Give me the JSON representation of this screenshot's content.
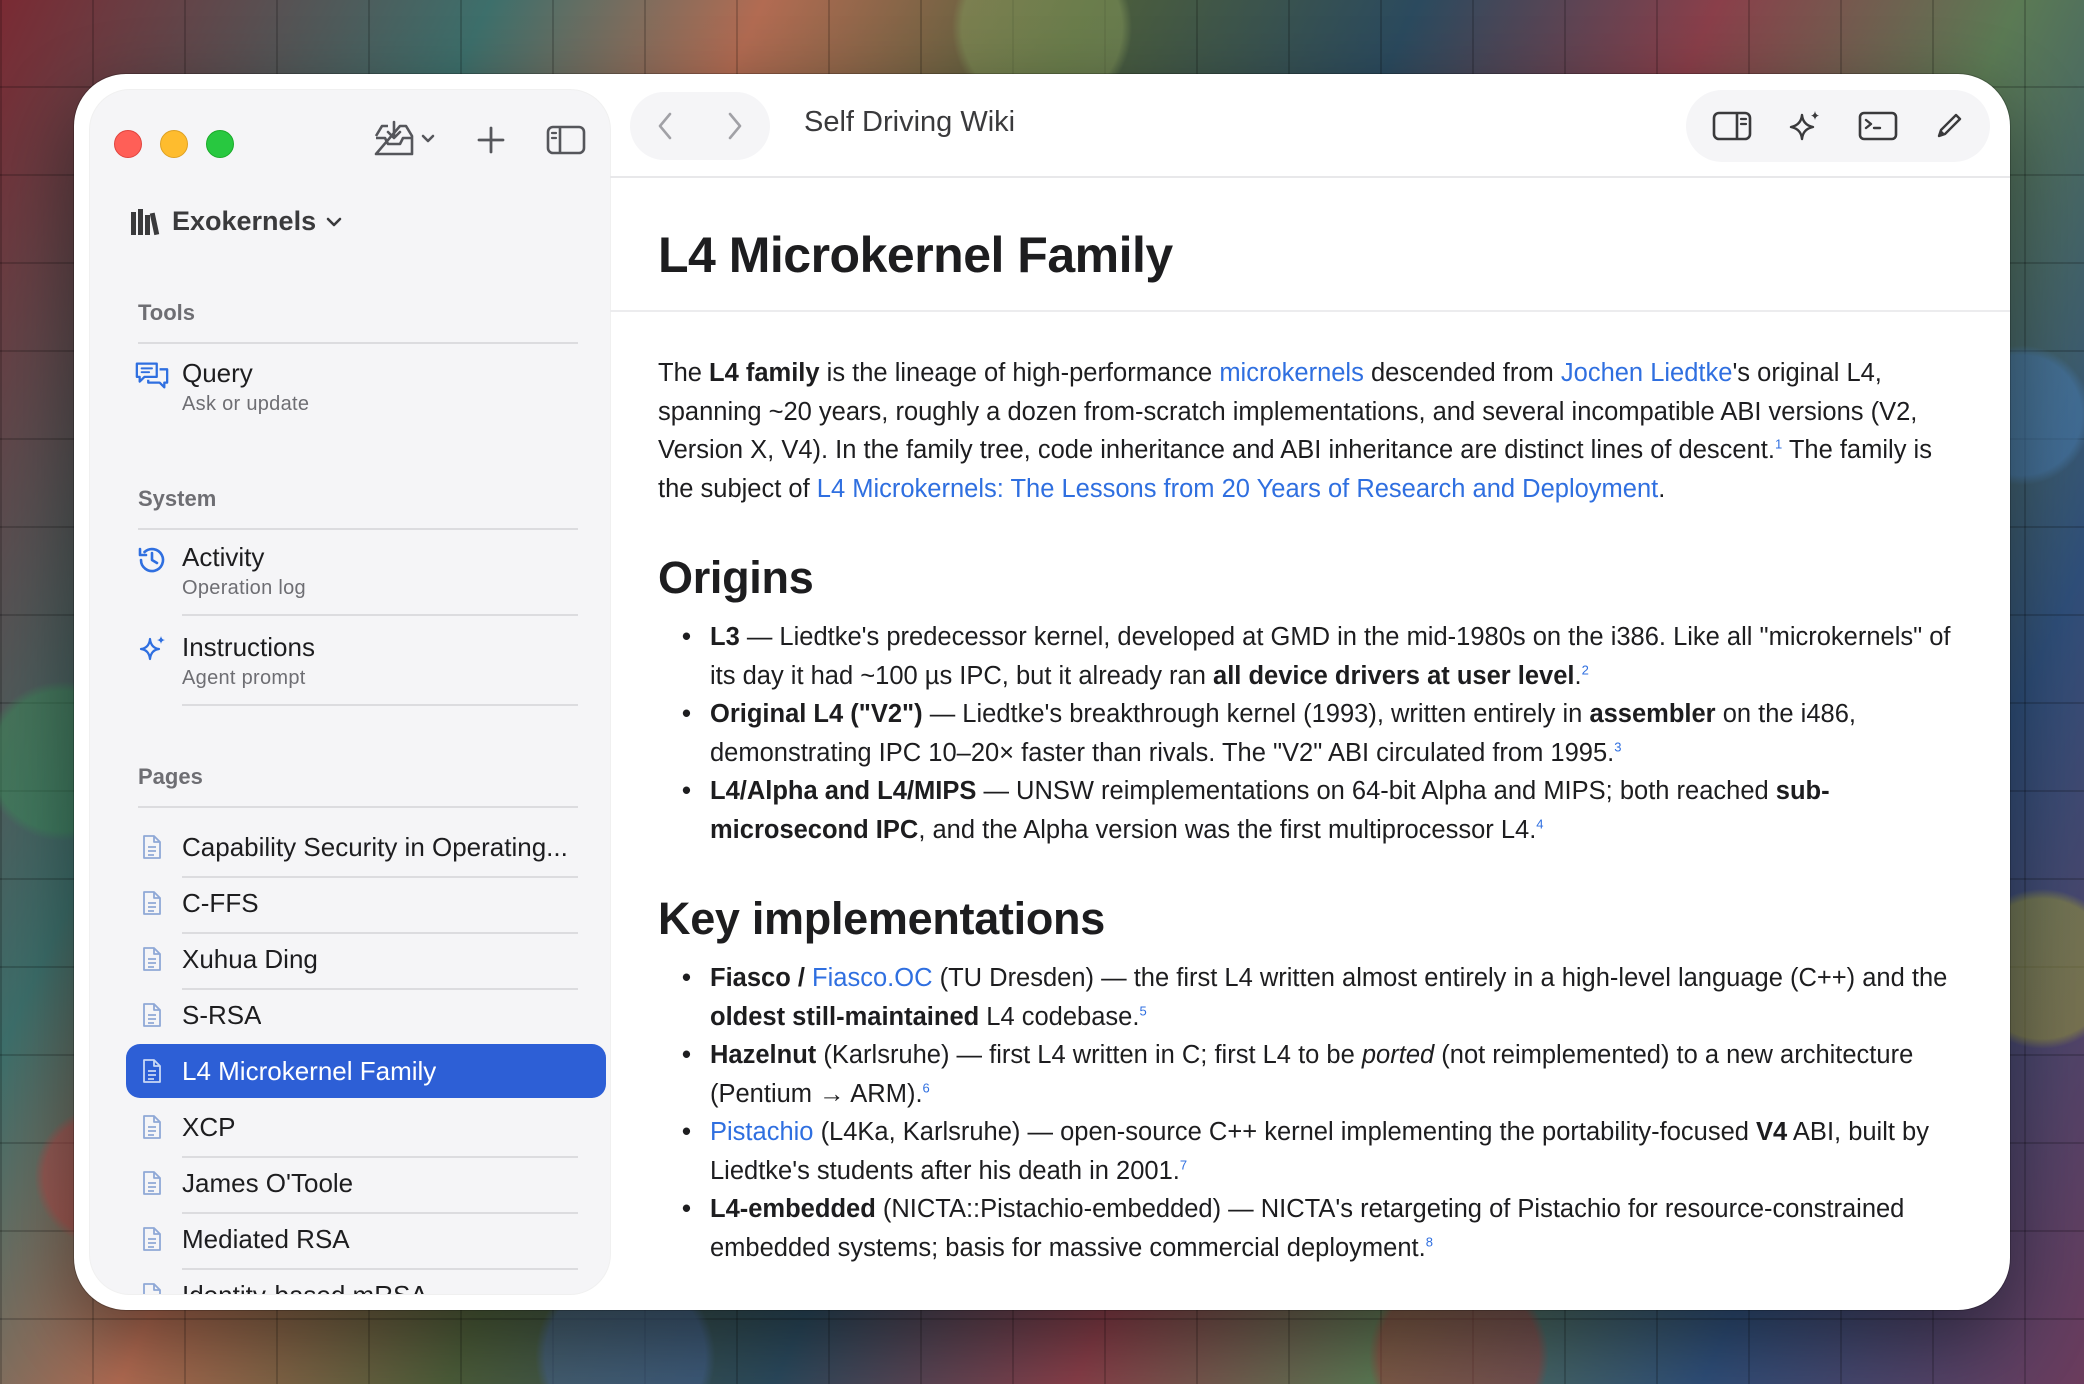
{
  "window": {
    "title": "Self Driving Wiki"
  },
  "sidebar": {
    "library_label": "Exokernels",
    "tools_title": "Tools",
    "tools": [
      {
        "title": "Query",
        "subtitle": "Ask or update"
      }
    ],
    "system_title": "System",
    "system": [
      {
        "title": "Activity",
        "subtitle": "Operation log"
      },
      {
        "title": "Instructions",
        "subtitle": "Agent prompt"
      }
    ],
    "pages_title": "Pages",
    "pages": [
      {
        "label": "Capability Security in Operating..."
      },
      {
        "label": "C-FFS"
      },
      {
        "label": "Xuhua Ding"
      },
      {
        "label": "S-RSA"
      },
      {
        "label": "L4 Microkernel Family",
        "active": true
      },
      {
        "label": "XCP"
      },
      {
        "label": "James O'Toole"
      },
      {
        "label": "Mediated RSA"
      },
      {
        "label": "Identity-based mRSA"
      }
    ]
  },
  "article": {
    "title": "L4 Microkernel Family",
    "intro": {
      "p1": "The ",
      "b1": "L4 family",
      "p2": " is the lineage of high-performance ",
      "l1": "microkernels",
      "p3": " descended from ",
      "l2": "Jochen Liedtke",
      "p4": "'s original L4, spanning ~20 years, roughly a dozen from-scratch implementations, and several incompatible ABI versions (V2, Version X, V4). In the family tree, code inheritance and ABI inheritance are distinct lines of descent.",
      "fn1": "1",
      "p5": " The family is the subject of ",
      "l3": "L4 Microkernels: The Lessons from 20 Years of Research and Deployment",
      "p6": "."
    },
    "origins_heading": "Origins",
    "origins": [
      {
        "b": "L3",
        "t": " — Liedtke's predecessor kernel, developed at GMD in the mid-1980s on the i386. Like all \"microkernels\" of its day it had ~100 µs IPC, but it already ran ",
        "b2": "all device drivers at user level",
        "t2": ".",
        "fn": "2"
      },
      {
        "b": "Original L4 (\"V2\")",
        "t": " — Liedtke's breakthrough kernel (1993), written entirely in ",
        "b2": "assembler",
        "t2": " on the i486, demonstrating IPC 10–20× faster than rivals. The \"V2\" ABI circulated from 1995.",
        "fn": "3"
      },
      {
        "b": "L4/Alpha and L4/MIPS",
        "t": " — UNSW reimplementations on 64-bit Alpha and MIPS; both reached ",
        "b2": "sub-microsecond IPC",
        "t2": ", and the Alpha version was the first multiprocessor L4.",
        "fn": "4"
      }
    ],
    "impl_heading": "Key implementations",
    "implementations": {
      "fiasco": {
        "b": "Fiasco / ",
        "l": "Fiasco.OC",
        "t": " (TU Dresden) — the first L4 written almost entirely in a high-level language (C++) and the ",
        "b2": "oldest still-maintained",
        "t2": " L4 codebase.",
        "fn": "5"
      },
      "hazelnut": {
        "b": "Hazelnut",
        "t": " (Karlsruhe) — first L4 written in C; first L4 to be ",
        "i": "ported",
        "t2": " (not reimplemented) to a new architecture (Pentium → ARM).",
        "fn": "6"
      },
      "pistachio": {
        "l": "Pistachio",
        "t": " (L4Ka, Karlsruhe) — open-source C++ kernel implementing the portability-focused ",
        "b2": "V4",
        "t2": " ABI, built by Liedtke's students after his death in 2001.",
        "fn": "7"
      },
      "embedded": {
        "b": "L4-embedded",
        "t": " (NICTA::Pistachio-embedded) — NICTA's retargeting of Pistachio for resource-constrained embedded systems; basis for massive commercial deployment.",
        "fn": "8"
      }
    }
  }
}
